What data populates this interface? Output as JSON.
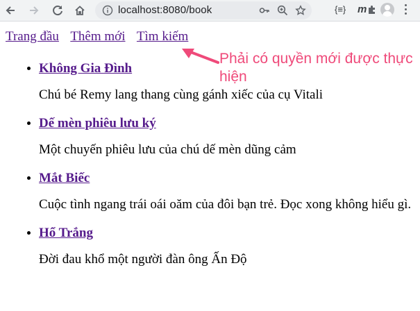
{
  "browser": {
    "url": "localhost:8080/book",
    "icons": [
      "back-icon",
      "forward-icon",
      "reload-icon",
      "home-icon",
      "info-icon",
      "key-icon",
      "zoom-icon",
      "star-icon",
      "json-extension-icon",
      "m-extension-icon",
      "extensions-puzzle-icon",
      "profile-avatar",
      "menu-icon"
    ],
    "json_ext_label": "{≡}",
    "m_ext_label": "m"
  },
  "nav": {
    "home": "Trang đầu",
    "add": "Thêm mới",
    "search": "Tìm kiếm"
  },
  "books": [
    {
      "title": "Không Gia Đình",
      "desc": "Chú bé Remy lang thang cùng gánh xiếc của cụ Vitali"
    },
    {
      "title": "Dế mèn phiêu lưu ký",
      "desc": "Một chuyến phiêu lưu của chú dế mèn dũng cảm"
    },
    {
      "title": "Mắt Biếc",
      "desc": "Cuộc tình ngang trái oái oăm của đôi bạn trẻ. Đọc xong không hiểu gì."
    },
    {
      "title": "Hổ Trắng",
      "desc": "Đời đau khổ một người đàn ông Ấn Độ"
    }
  ],
  "annotation": {
    "text": "Phải có quyền mới được thực hiện",
    "color": "#ef4a7a"
  },
  "colors": {
    "link_visited": "#551a8b",
    "toolbar_bg": "#f1f3f4"
  }
}
